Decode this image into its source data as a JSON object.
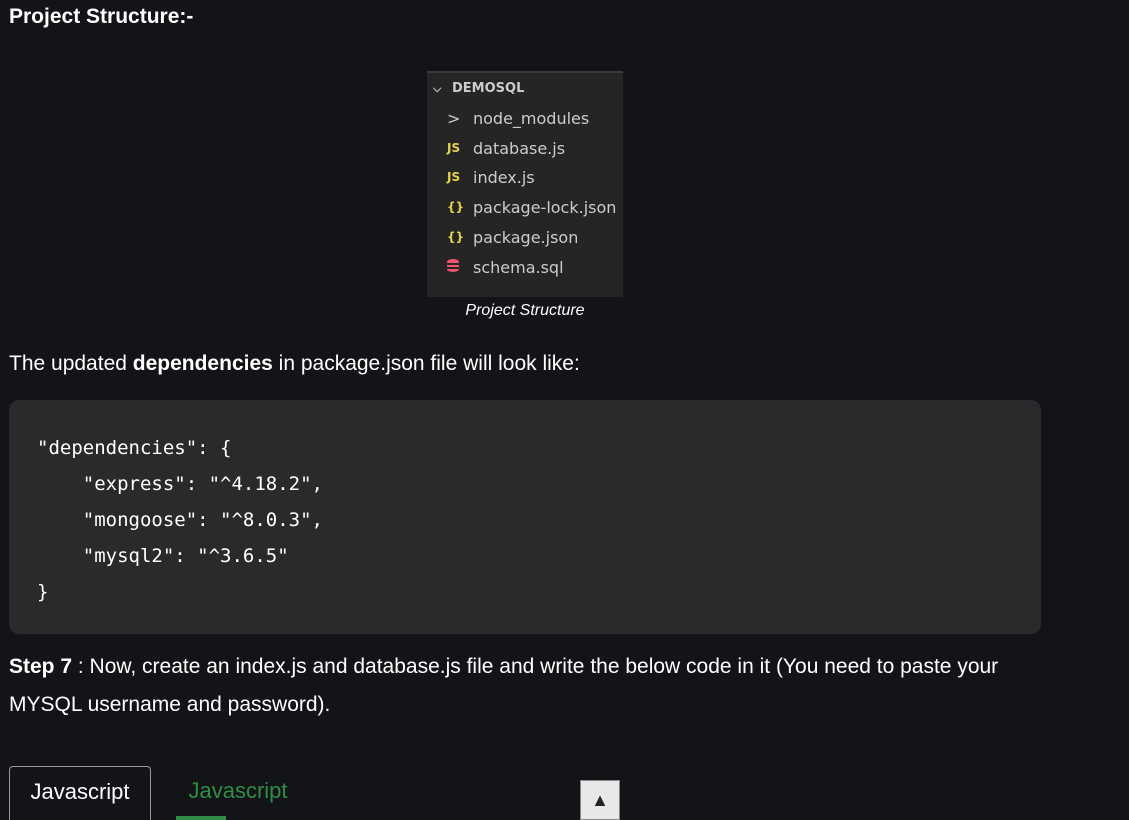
{
  "heading": "Project Structure:-",
  "explorer": {
    "root_label": "DEMOSQL",
    "items": [
      {
        "icon": "chevron-right",
        "glyph": ">",
        "label": "node_modules"
      },
      {
        "icon": "js-file",
        "glyph": "JS",
        "label": "database.js"
      },
      {
        "icon": "js-file",
        "glyph": "JS",
        "label": "index.js"
      },
      {
        "icon": "json-file",
        "glyph": "{}",
        "label": "package-lock.json"
      },
      {
        "icon": "json-file",
        "glyph": "{}",
        "label": "package.json"
      },
      {
        "icon": "database-file",
        "glyph": "",
        "label": "schema.sql"
      }
    ]
  },
  "caption": "Project Structure",
  "para": {
    "before": "The updated ",
    "bold": "dependencies",
    "after": " in package.json file will look like:"
  },
  "code": "\"dependencies\": {\n    \"express\": \"^4.18.2\",\n    \"mongoose\": \"^8.0.3\",\n    \"mysql2\": \"^3.6.5\"\n}",
  "step": {
    "bold": "Step 7",
    "text": " : Now, create an index.js and database.js file and write the below code in it (You need to paste your MYSQL username and password)."
  },
  "tabs": {
    "active": "Javascript",
    "inactive": "Javascript"
  },
  "scroll_top_glyph": "▲",
  "colors": {
    "background": "#131417",
    "code_background": "#2a2a2c",
    "accent_green": "#2f8d46",
    "js_icon": "#e8d44d",
    "db_icon": "#f0556b"
  }
}
